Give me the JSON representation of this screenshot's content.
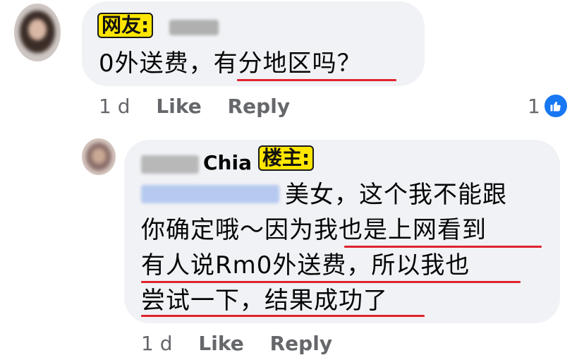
{
  "comments": [
    {
      "tag": "网友:",
      "text": "0外送费，有分地区吗？",
      "time": "1 d",
      "like_label": "Like",
      "reply_label": "Reply",
      "reactions": "1"
    },
    {
      "author_visible": "Chia",
      "tag": "楼主:",
      "lines": [
        "美女，这个我不能跟",
        "你确定哦～因为我也是上网看到",
        "有人说Rm0外送费，所以我也",
        "尝试一下，结果成功了"
      ],
      "time": "1 d",
      "like_label": "Like",
      "reply_label": "Reply"
    }
  ],
  "colors": {
    "bubble": "#f0f2f5",
    "underline": "#e0242d",
    "tag_bg": "#ffe600",
    "like_blue": "#1877f2",
    "meta_gray": "#65676b"
  },
  "icons": [
    "like-thumb-icon"
  ]
}
